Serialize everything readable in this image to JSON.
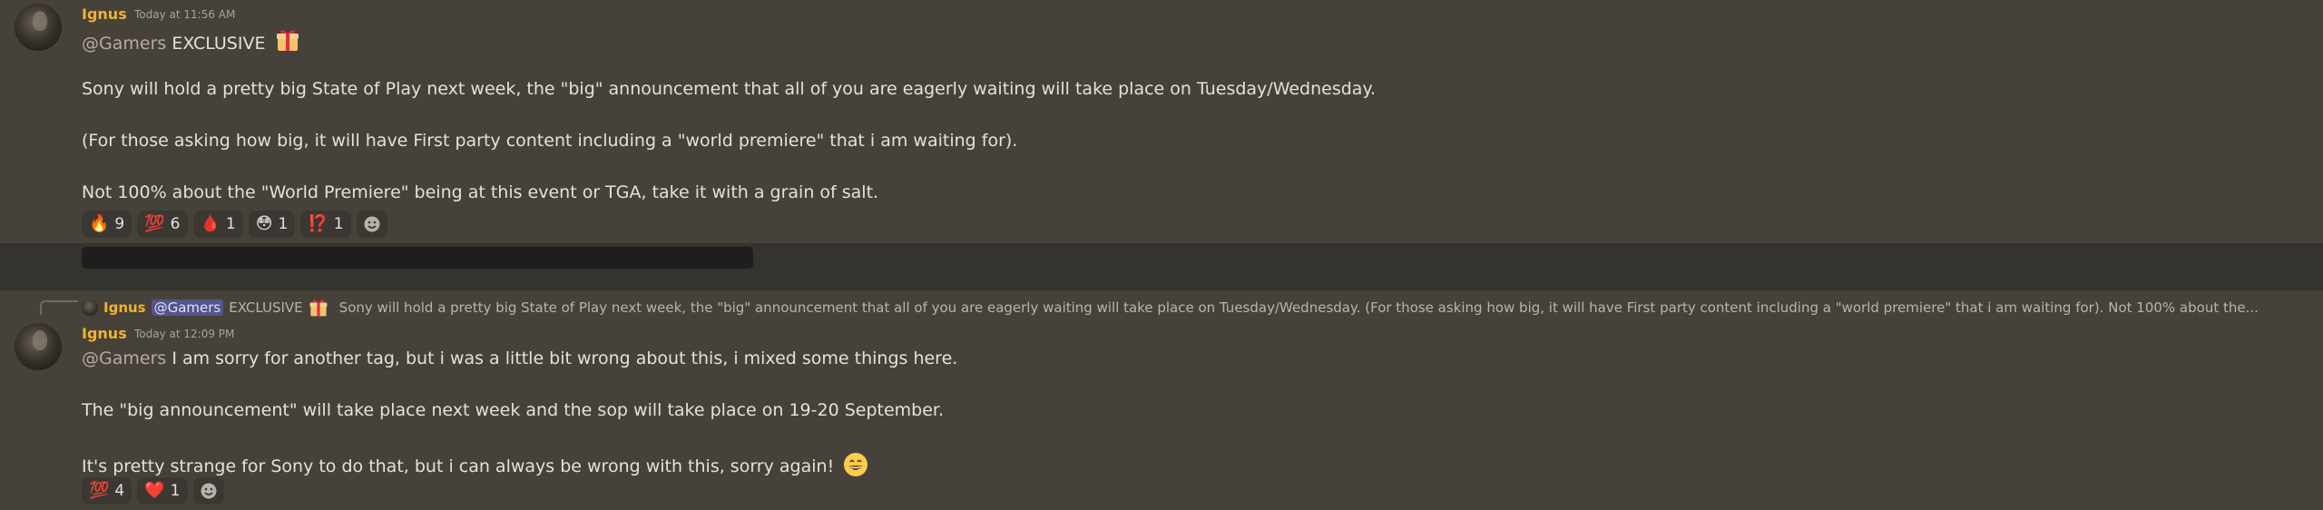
{
  "messages": [
    {
      "username": "Ignus",
      "timestamp": "Today at 11:56 AM",
      "mention": "@Gamers",
      "headline": "EXCLUSIVE",
      "lines": [
        "Sony will hold a pretty big State of Play next week, the \"big\" announcement that all of you are eagerly waiting will take place on Tuesday/Wednesday.",
        "(For those asking how big, it will have First party content including a \"world premiere\" that i am waiting for).",
        "Not 100% about the \"World Premiere\" being at this event or TGA, take it with a grain of salt."
      ],
      "reactions": [
        {
          "emoji": "🔥",
          "count": "9"
        },
        {
          "emoji": "💯",
          "count": "6"
        },
        {
          "emoji": "🩸",
          "count": "1"
        },
        {
          "emoji": "😳",
          "count": "1"
        },
        {
          "emoji": "⁉️",
          "count": "1"
        }
      ]
    },
    {
      "username": "Ignus",
      "timestamp": "Today at 12:09 PM",
      "mention": "@Gamers",
      "lines": [
        "I am sorry for another tag, but i was a little bit wrong about this, i mixed some things here.",
        "The \"big announcement\" will take place next week and the sop will take place on 19-20 September.",
        "It's pretty strange for Sony to do that, but i can always be wrong with this, sorry again!"
      ],
      "reactions": [
        {
          "emoji": "💯",
          "count": "4"
        },
        {
          "emoji": "❤️",
          "count": "1"
        }
      ]
    }
  ],
  "reply_preview": {
    "username": "Ignus",
    "mention": "@Gamers",
    "headline": "EXCLUSIVE",
    "text": "Sony will hold a pretty big State of Play next week, the \"big\" announcement that all of you are eagerly waiting will take place on Tuesday/Wednesday.  (For those asking how big, it will have First party content including a \"world premiere\" that i am waiting for).  Not 100% about the..."
  },
  "icons": {
    "gift": "gift-icon",
    "add_reaction": "add-reaction-icon",
    "grin": "grinning-face-icon"
  }
}
